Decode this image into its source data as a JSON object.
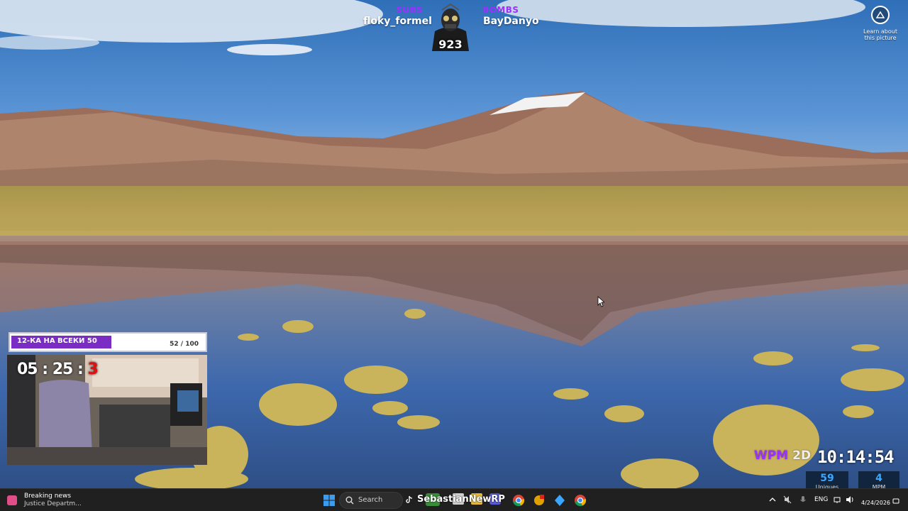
{
  "overlay": {
    "subs_label": "SUBS",
    "subs_name": "floky_formel",
    "bombs_label": "BOMBS",
    "bombs_name": "BayDanyo",
    "counter": "923"
  },
  "desktop": {
    "learn_about_picture": "Learn about this picture"
  },
  "goal": {
    "title": "12-КА НА ВСЕКИ 50",
    "current": 52,
    "target": 100,
    "count_text": "52 / 100"
  },
  "webcam": {
    "timer_prefix": "05 : 25 : ",
    "timer_red": "3"
  },
  "stats": {
    "wpm_label": "WPM",
    "mode": "2D",
    "clock": "10:14:54",
    "uniques_value": "59",
    "uniques_label": "Uniques",
    "mpm_value": "4",
    "mpm_label": "MPM"
  },
  "taskbar": {
    "news_title": "Breaking news",
    "news_subtitle": "Justice Departm...",
    "search_placeholder": "Search",
    "stream_overlay_name": "SebastianNewRP",
    "language": "ENG",
    "date": "4/24/2026"
  },
  "icons": {
    "start": "windows-start-icon",
    "search": "search-icon",
    "tiktok": "tiktok-icon",
    "chrome": "chrome-icon",
    "tray_chevron": "chevron-up-icon"
  },
  "colors": {
    "accent_purple": "#9b30ff",
    "taskbar": "#202020",
    "stat_blue": "#3aa6ff",
    "timer_red": "#e01010"
  }
}
